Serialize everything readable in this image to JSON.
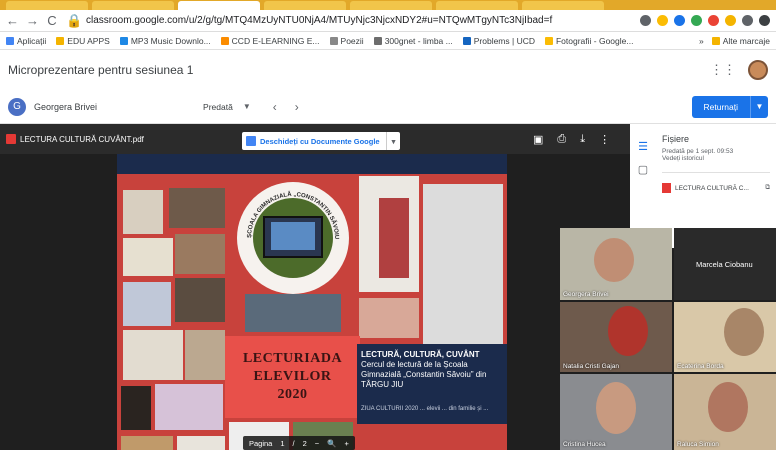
{
  "browser": {
    "url": "classroom.google.com/u/2/g/tg/MTQ4MzUyNTU0NjA4/MTUyNjc3NjcxNDY2#u=NTQwMTgyNTc3NjIbad=f",
    "bookmarks": [
      "Aplicații",
      "EDU APPS",
      "MP3 Music Downlo...",
      "CCD E-LEARNING E...",
      "Poezii",
      "300gnet - limba ...",
      "Problems | UCD",
      "Fotografii - Google..."
    ],
    "other_bookmarks": "Alte marcaje"
  },
  "app": {
    "title": "Microprezentare pentru sesiunea 1"
  },
  "userbar": {
    "student_initial": "G",
    "student_name": "Georgera Brivei",
    "status": "Predată",
    "return_label": "Returnați"
  },
  "viewer": {
    "file_name": "LECTURA CULTURĂ CUVÂNT.pdf",
    "open_with": "Deschideți cu Documente Google",
    "page_label": "Pagina",
    "page_current": "1",
    "page_sep": "/",
    "page_total": "2"
  },
  "poster": {
    "circle_text": "ȘCOALA GIMNAZIALĂ „CONSTANTIN SĂVOIU”",
    "title_line1": "LECTURIADA",
    "title_line2": "ELEVILOR",
    "title_line3": "2020",
    "blue_line1": "LECTURĂ, CULTURĂ, CUVÂNT",
    "blue_line2": "Cercul de lectură de la Școala Gimnazială „Constantin Săvoiu” din TÂRGU JIU",
    "blue_small": "ZIUA CULTURII 2020 ... elevii ... din familie și ... "
  },
  "files_panel": {
    "title": "Fișiere",
    "date": "Predată pe 1 sept. 09:53",
    "view_history": "Vedeți istoricul",
    "file_item": "LECTURA CULTURĂ C..."
  },
  "participants": [
    {
      "name": "Georgera Brivei"
    },
    {
      "name": "Marcela Ciobanu"
    },
    {
      "name": "Natalia Cristi Gajan"
    },
    {
      "name": "Ecaterina Borda"
    },
    {
      "name": "Cristina Hucea"
    },
    {
      "name": "Raluca Simion"
    }
  ],
  "colors": {
    "accent": "#1a73e8",
    "poster_red": "#c8423c",
    "poster_blue": "#1b2b4c"
  }
}
